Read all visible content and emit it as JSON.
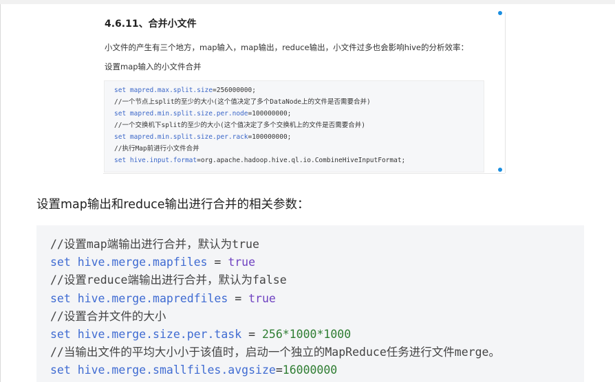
{
  "doc": {
    "heading": "4.6.11、合并小文件",
    "paragraph": "小文件的产生有三个地方，map输入，map输出，reduce输出，小文件过多也会影响hive的分析效率：",
    "subheading": "设置map输入的小文件合并",
    "code": [
      {
        "kw": "set",
        "prop": " mapred.max.split.size",
        "rest": "=256000000;"
      },
      {
        "comment": "//一个节点上split的至少的大小(这个值决定了多个DataNode上的文件是否需要合并)"
      },
      {
        "kw": "set",
        "prop": " mapred.min.split.size.per.node",
        "rest": "=100000000;"
      },
      {
        "comment": "//一个交换机下split的至少的大小(这个值决定了多个交换机上的文件是否需要合并)"
      },
      {
        "kw": "set",
        "prop": " mapred.min.split.size.per.rack",
        "rest": "=100000000;"
      },
      {
        "comment": "//执行Map前进行小文件合并"
      },
      {
        "kw": "set",
        "prop": " hive.input.format",
        "rest": "=org.apache.hadoop.hive.ql.io.CombineHiveInputFormat;"
      }
    ]
  },
  "section": {
    "heading": "设置map输出和reduce输出进行合并的相关参数：",
    "code": [
      {
        "comment": "//设置map端输出进行合并，默认为true"
      },
      {
        "kw": "set",
        "prop": " hive.merge.mapfiles",
        "op": " = ",
        "val": "true"
      },
      {
        "comment": "//设置reduce端输出进行合并，默认为false"
      },
      {
        "kw": "set",
        "prop": " hive.merge.mapredfiles",
        "op": " = ",
        "val": "true"
      },
      {
        "comment": "//设置合并文件的大小"
      },
      {
        "kw": "set",
        "prop": " hive.merge.size.per.task",
        "op": " = ",
        "num": "256*1000*1000"
      },
      {
        "comment": "//当输出文件的平均大小小于该值时，启动一个独立的MapReduce任务进行文件merge。"
      },
      {
        "kw": "set",
        "prop": " hive.merge.smallfiles.avgsize",
        "op": "=",
        "num": "16000000"
      }
    ]
  }
}
